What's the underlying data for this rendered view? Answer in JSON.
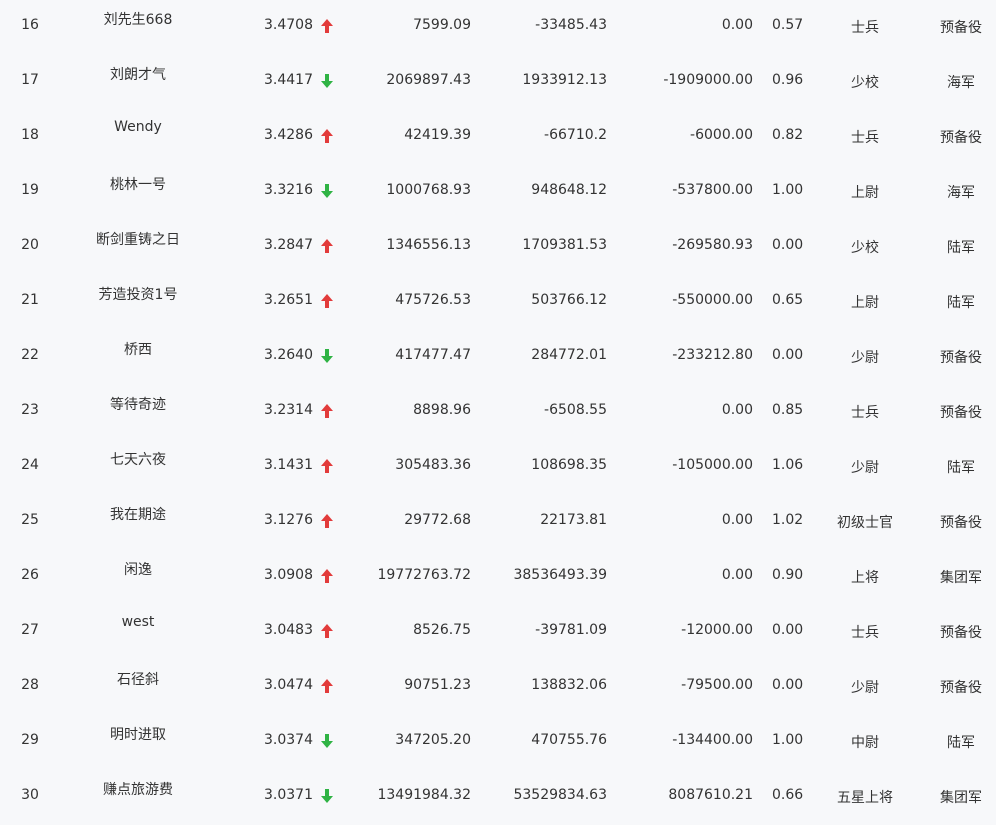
{
  "colors": {
    "up": "#e23b3b",
    "down": "#2fb344"
  },
  "rows": [
    {
      "rank": "16",
      "name": "刘先生668",
      "score": "3.4708",
      "trend": "up",
      "v1": "7599.09",
      "v2": "-33485.43",
      "v3": "0.00",
      "ratio": "0.57",
      "title": "士兵",
      "group": "预备役"
    },
    {
      "rank": "17",
      "name": "刘朗才气",
      "score": "3.4417",
      "trend": "down",
      "v1": "2069897.43",
      "v2": "1933912.13",
      "v3": "-1909000.00",
      "ratio": "0.96",
      "title": "少校",
      "group": "海军"
    },
    {
      "rank": "18",
      "name": "Wendy",
      "score": "3.4286",
      "trend": "up",
      "v1": "42419.39",
      "v2": "-66710.2",
      "v3": "-6000.00",
      "ratio": "0.82",
      "title": "士兵",
      "group": "预备役"
    },
    {
      "rank": "19",
      "name": "桃林一号",
      "score": "3.3216",
      "trend": "down",
      "v1": "1000768.93",
      "v2": "948648.12",
      "v3": "-537800.00",
      "ratio": "1.00",
      "title": "上尉",
      "group": "海军"
    },
    {
      "rank": "20",
      "name": "断剑重铸之日",
      "score": "3.2847",
      "trend": "up",
      "v1": "1346556.13",
      "v2": "1709381.53",
      "v3": "-269580.93",
      "ratio": "0.00",
      "title": "少校",
      "group": "陆军"
    },
    {
      "rank": "21",
      "name": "芳造投资1号",
      "score": "3.2651",
      "trend": "up",
      "v1": "475726.53",
      "v2": "503766.12",
      "v3": "-550000.00",
      "ratio": "0.65",
      "title": "上尉",
      "group": "陆军"
    },
    {
      "rank": "22",
      "name": "桥西",
      "score": "3.2640",
      "trend": "down",
      "v1": "417477.47",
      "v2": "284772.01",
      "v3": "-233212.80",
      "ratio": "0.00",
      "title": "少尉",
      "group": "预备役"
    },
    {
      "rank": "23",
      "name": "等待奇迹",
      "score": "3.2314",
      "trend": "up",
      "v1": "8898.96",
      "v2": "-6508.55",
      "v3": "0.00",
      "ratio": "0.85",
      "title": "士兵",
      "group": "预备役"
    },
    {
      "rank": "24",
      "name": "七天六夜",
      "score": "3.1431",
      "trend": "up",
      "v1": "305483.36",
      "v2": "108698.35",
      "v3": "-105000.00",
      "ratio": "1.06",
      "title": "少尉",
      "group": "陆军"
    },
    {
      "rank": "25",
      "name": "我在期途",
      "score": "3.1276",
      "trend": "up",
      "v1": "29772.68",
      "v2": "22173.81",
      "v3": "0.00",
      "ratio": "1.02",
      "title": "初级士官",
      "group": "预备役"
    },
    {
      "rank": "26",
      "name": "闲逸",
      "score": "3.0908",
      "trend": "up",
      "v1": "19772763.72",
      "v2": "38536493.39",
      "v3": "0.00",
      "ratio": "0.90",
      "title": "上将",
      "group": "集团军"
    },
    {
      "rank": "27",
      "name": "west",
      "score": "3.0483",
      "trend": "up",
      "v1": "8526.75",
      "v2": "-39781.09",
      "v3": "-12000.00",
      "ratio": "0.00",
      "title": "士兵",
      "group": "预备役"
    },
    {
      "rank": "28",
      "name": "石径斜",
      "score": "3.0474",
      "trend": "up",
      "v1": "90751.23",
      "v2": "138832.06",
      "v3": "-79500.00",
      "ratio": "0.00",
      "title": "少尉",
      "group": "预备役"
    },
    {
      "rank": "29",
      "name": "明时进取",
      "score": "3.0374",
      "trend": "down",
      "v1": "347205.20",
      "v2": "470755.76",
      "v3": "-134400.00",
      "ratio": "1.00",
      "title": "中尉",
      "group": "陆军"
    },
    {
      "rank": "30",
      "name": "赚点旅游费",
      "score": "3.0371",
      "trend": "down",
      "v1": "13491984.32",
      "v2": "53529834.63",
      "v3": "8087610.21",
      "ratio": "0.66",
      "title": "五星上将",
      "group": "集团军"
    }
  ]
}
